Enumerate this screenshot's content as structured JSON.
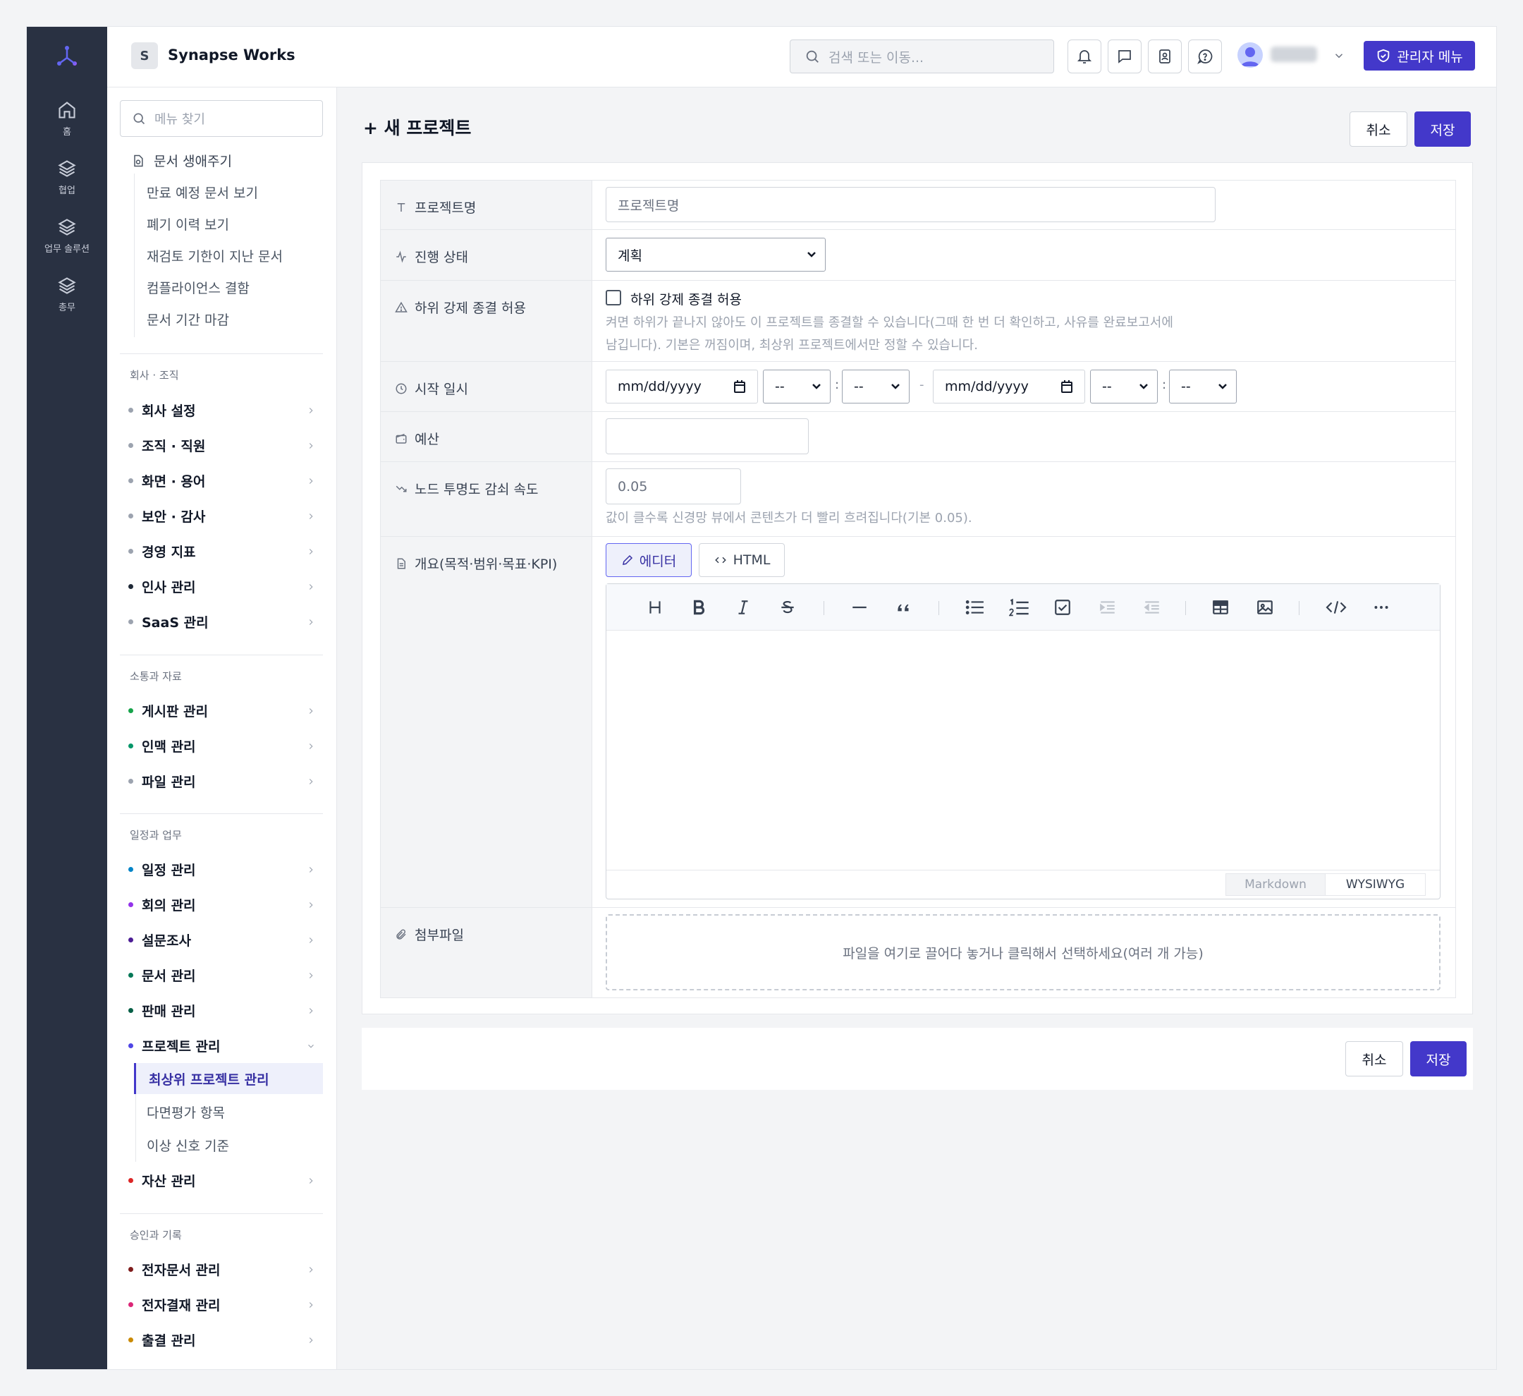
{
  "rail": {
    "items": [
      "홈",
      "협업",
      "업무 솔루션",
      "총무"
    ]
  },
  "header": {
    "workspace_initial": "S",
    "workspace_name": "Synapse Works",
    "search_placeholder": "검색 또는 이동...",
    "admin_menu": "관리자 메뉴"
  },
  "sidebar": {
    "search_placeholder": "메뉴 찾기",
    "lifecycle": {
      "title": "문서 생애주기",
      "links": [
        "만료 예정 문서 보기",
        "폐기 이력 보기",
        "재검토 기한이 지난 문서",
        "컴플라이언스 결함",
        "문서 기간 마감"
      ]
    },
    "sections": [
      {
        "title": "회사 · 조직",
        "items": [
          {
            "label": "회사 설정",
            "color": "#9ca3af"
          },
          {
            "label": "조직 · 직원",
            "color": "#9ca3af"
          },
          {
            "label": "화면 · 용어",
            "color": "#9ca3af"
          },
          {
            "label": "보안 · 감사",
            "color": "#9ca3af"
          },
          {
            "label": "경영 지표",
            "color": "#9ca3af"
          },
          {
            "label": "인사 관리",
            "color": "#1f2937"
          },
          {
            "label": "SaaS 관리",
            "color": "#9ca3af"
          }
        ]
      },
      {
        "title": "소통과 자료",
        "items": [
          {
            "label": "게시판 관리",
            "color": "#16a34a"
          },
          {
            "label": "인맥 관리",
            "color": "#059669"
          },
          {
            "label": "파일 관리",
            "color": "#9ca3af"
          }
        ]
      },
      {
        "title": "일정과 업무",
        "items": [
          {
            "label": "일정 관리",
            "color": "#0284c7"
          },
          {
            "label": "회의 관리",
            "color": "#9333ea"
          },
          {
            "label": "설문조사",
            "color": "#4c1d95"
          },
          {
            "label": "문서 관리",
            "color": "#047857"
          },
          {
            "label": "판매 관리",
            "color": "#065f46"
          },
          {
            "label": "프로젝트 관리",
            "color": "#4f46e5"
          },
          {
            "label": "자산 관리",
            "color": "#dc2626"
          }
        ]
      },
      {
        "title": "승인과 기록",
        "items": [
          {
            "label": "전자문서 관리",
            "color": "#7f1d1d"
          },
          {
            "label": "전자결재 관리",
            "color": "#db2777"
          },
          {
            "label": "출결 관리",
            "color": "#ca8a04"
          }
        ]
      }
    ],
    "project_sub": [
      "최상위 프로젝트 관리",
      "다면평가 항목",
      "이상 신호 기준"
    ]
  },
  "main": {
    "title": "+ 새 프로젝트",
    "cancel": "취소",
    "save": "저장",
    "form": {
      "name_label": "프로젝트명",
      "name_placeholder": "프로젝트명",
      "status_label": "진행 상태",
      "status_value": "계획",
      "force_label": "하위 강제 종결 허용",
      "force_checkbox": "하위 강제 종결 허용",
      "force_help_1": "켜면 하위가 끝나지 않아도 이 프로젝트를 종결할 수 있습니다(그때 한 번 더 확인하고, 사유를 완료보고서에",
      "force_help_2": "남깁니다). 기본은 꺼짐이며, 최상위 프로젝트에서만 정할 수 있습니다.",
      "start_label": "시작 일시",
      "date_placeholder": "mm/dd/yyyy",
      "time_placeholder": "--",
      "budget_label": "예산",
      "decay_label": "노드 투명도 감쇠 속도",
      "decay_value": "0.05",
      "decay_help": "값이 클수록 신경망 뷰에서 콘텐츠가 더 빨리 흐려집니다(기본 0.05).",
      "overview_label": "개요(목적·범위·목표·KPI)",
      "tab_editor": "에디터",
      "tab_html": "HTML",
      "mode_markdown": "Markdown",
      "mode_wysiwyg": "WYSIWYG",
      "attach_label": "첨부파일",
      "attach_help": "파일을 여기로 끌어다 놓거나 클릭해서 선택하세요(여러 개 가능)"
    }
  }
}
